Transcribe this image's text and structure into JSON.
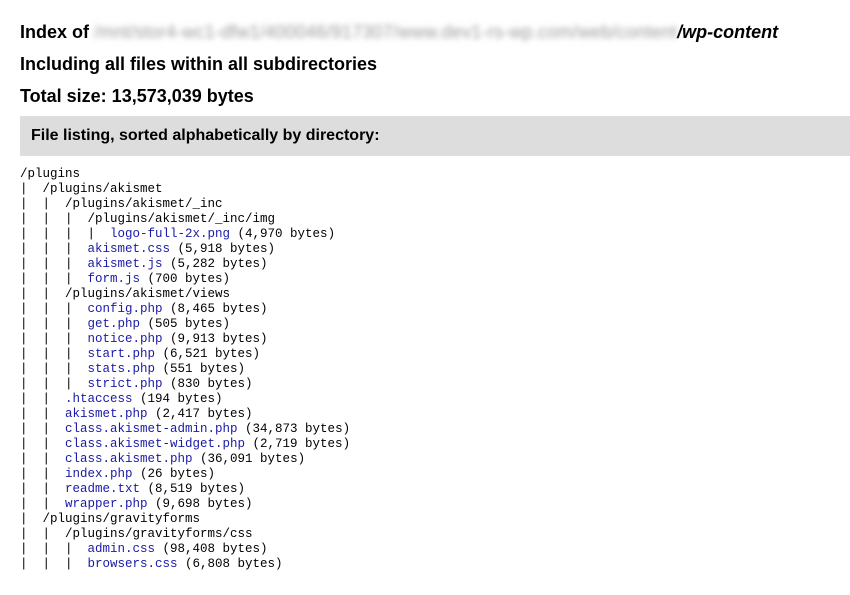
{
  "header": {
    "index_prefix": "Index of ",
    "path_obscured": "/mnt/stor4-wc1-dfw1/400046/917307/www.dev1-rs-wp.com/web/content",
    "path_tail": "/wp-content",
    "including": "Including all files within all subdirectories",
    "total_size": "Total size: 13,573,039 bytes"
  },
  "listing": {
    "heading": "File listing, sorted alphabetically by directory:"
  },
  "tree": [
    {
      "prefix": "",
      "name": "/plugins",
      "type": "dir",
      "size": ""
    },
    {
      "prefix": "|  ",
      "name": "/plugins/akismet",
      "type": "dir",
      "size": ""
    },
    {
      "prefix": "|  |  ",
      "name": "/plugins/akismet/_inc",
      "type": "dir",
      "size": ""
    },
    {
      "prefix": "|  |  |  ",
      "name": "/plugins/akismet/_inc/img",
      "type": "dir",
      "size": ""
    },
    {
      "prefix": "|  |  |  |  ",
      "name": "logo-full-2x.png",
      "type": "file",
      "size": " (4,970 bytes)"
    },
    {
      "prefix": "|  |  |  ",
      "name": "akismet.css",
      "type": "file",
      "size": " (5,918 bytes)"
    },
    {
      "prefix": "|  |  |  ",
      "name": "akismet.js",
      "type": "file",
      "size": " (5,282 bytes)"
    },
    {
      "prefix": "|  |  |  ",
      "name": "form.js",
      "type": "file",
      "size": " (700 bytes)"
    },
    {
      "prefix": "|  |  ",
      "name": "/plugins/akismet/views",
      "type": "dir",
      "size": ""
    },
    {
      "prefix": "|  |  |  ",
      "name": "config.php",
      "type": "file",
      "size": " (8,465 bytes)"
    },
    {
      "prefix": "|  |  |  ",
      "name": "get.php",
      "type": "file",
      "size": " (505 bytes)"
    },
    {
      "prefix": "|  |  |  ",
      "name": "notice.php",
      "type": "file",
      "size": " (9,913 bytes)"
    },
    {
      "prefix": "|  |  |  ",
      "name": "start.php",
      "type": "file",
      "size": " (6,521 bytes)"
    },
    {
      "prefix": "|  |  |  ",
      "name": "stats.php",
      "type": "file",
      "size": " (551 bytes)"
    },
    {
      "prefix": "|  |  |  ",
      "name": "strict.php",
      "type": "file",
      "size": " (830 bytes)"
    },
    {
      "prefix": "|  |  ",
      "name": ".htaccess",
      "type": "file",
      "size": " (194 bytes)"
    },
    {
      "prefix": "|  |  ",
      "name": "akismet.php",
      "type": "file",
      "size": " (2,417 bytes)"
    },
    {
      "prefix": "|  |  ",
      "name": "class.akismet-admin.php",
      "type": "file",
      "size": " (34,873 bytes)"
    },
    {
      "prefix": "|  |  ",
      "name": "class.akismet-widget.php",
      "type": "file",
      "size": " (2,719 bytes)"
    },
    {
      "prefix": "|  |  ",
      "name": "class.akismet.php",
      "type": "file",
      "size": " (36,091 bytes)"
    },
    {
      "prefix": "|  |  ",
      "name": "index.php",
      "type": "file",
      "size": " (26 bytes)"
    },
    {
      "prefix": "|  |  ",
      "name": "readme.txt",
      "type": "file",
      "size": " (8,519 bytes)"
    },
    {
      "prefix": "|  |  ",
      "name": "wrapper.php",
      "type": "file",
      "size": " (9,698 bytes)"
    },
    {
      "prefix": "|  ",
      "name": "/plugins/gravityforms",
      "type": "dir",
      "size": ""
    },
    {
      "prefix": "|  |  ",
      "name": "/plugins/gravityforms/css",
      "type": "dir",
      "size": ""
    },
    {
      "prefix": "|  |  |  ",
      "name": "admin.css",
      "type": "file",
      "size": " (98,408 bytes)"
    },
    {
      "prefix": "|  |  |  ",
      "name": "browsers.css",
      "type": "file",
      "size": " (6,808 bytes)"
    }
  ],
  "colors": {
    "link": "#1a1aa6",
    "heading_bar": "#dddddd"
  }
}
